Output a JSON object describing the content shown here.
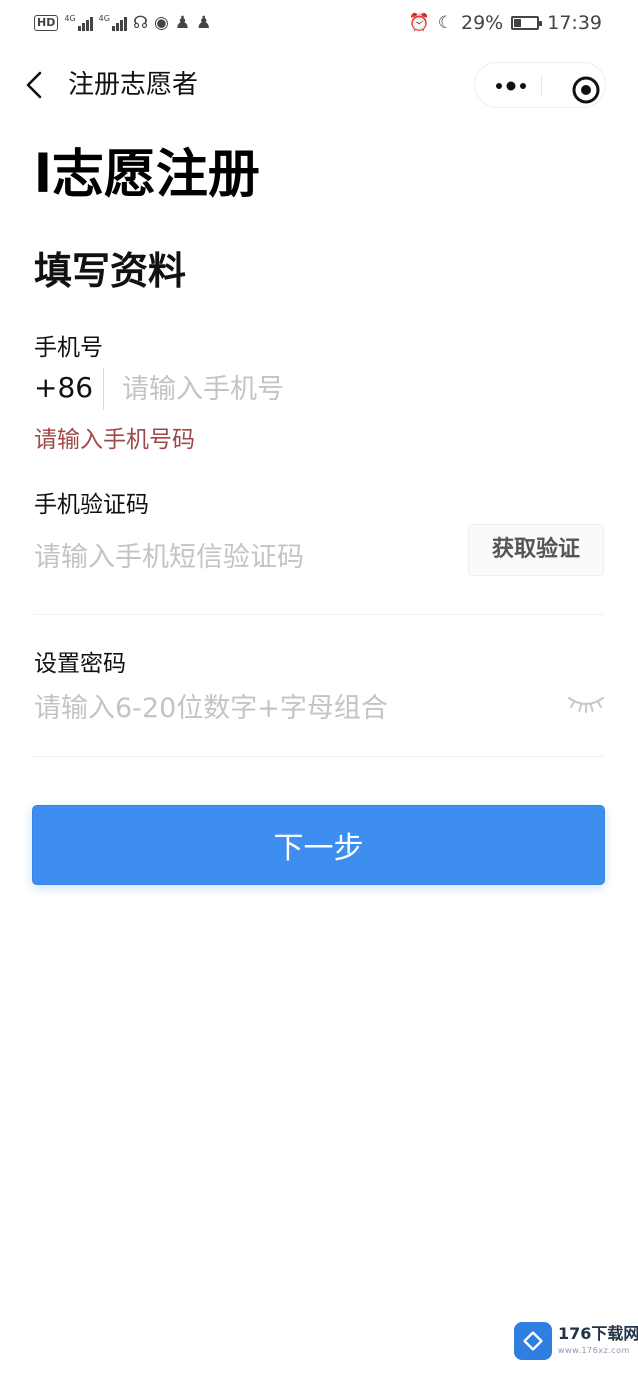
{
  "status_bar": {
    "network_badge": "HD",
    "signal_1_tag": "4G",
    "signal_2_tag": "4G",
    "battery": "29%",
    "time": "17:39"
  },
  "nav_bar": {
    "title": "注册志愿者",
    "back_icon": "chevron-left-icon",
    "more_icon": "more-dots-icon",
    "close_icon": "target-close-icon"
  },
  "page": {
    "title": "l志愿注册",
    "section_title": "填写资料"
  },
  "form": {
    "phone": {
      "label": "手机号",
      "prefix": "+86",
      "value": "",
      "placeholder": "请输入手机号",
      "error": "请输入手机号码"
    },
    "code": {
      "label": "手机验证码",
      "value": "",
      "placeholder": "请输入手机短信验证码",
      "button_label": "获取验证"
    },
    "password": {
      "label": "设置密码",
      "value": "",
      "placeholder": "请输入6-20位数字+字母组合",
      "toggle_icon": "eye-closed-icon"
    },
    "submit_label": "下一步"
  },
  "colors": {
    "primary": "#3e8ef0",
    "error": "#a04848",
    "placeholder": "#c4c4c4"
  },
  "watermark": {
    "brand": "176下载网",
    "url": "www.176xz.com"
  }
}
